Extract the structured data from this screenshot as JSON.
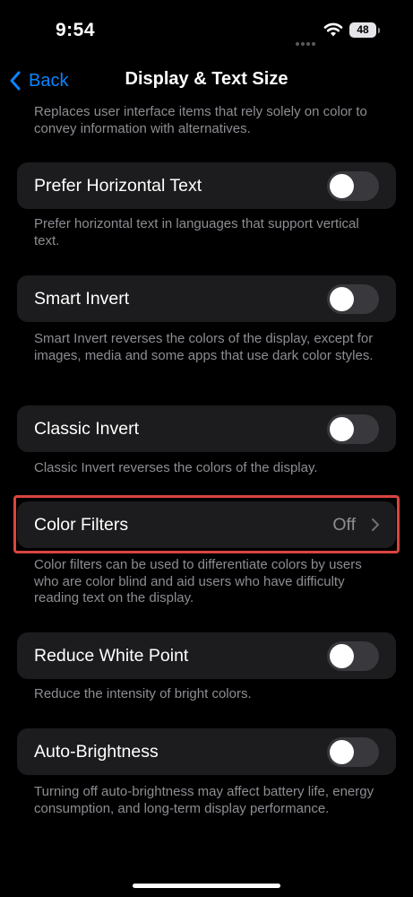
{
  "status_bar": {
    "time": "9:54",
    "battery": "48"
  },
  "nav": {
    "back_label": "Back",
    "title": "Display & Text Size"
  },
  "items": [
    {
      "footer": "Replaces user interface items that rely solely on color to convey information with alternatives."
    },
    {
      "label": "Prefer Horizontal Text",
      "toggle_on": false,
      "footer": "Prefer horizontal text in languages that support vertical text."
    },
    {
      "label": "Smart Invert",
      "toggle_on": false,
      "footer": "Smart Invert reverses the colors of the display, except for images, media and some apps that use dark color styles."
    },
    {
      "label": "Classic Invert",
      "toggle_on": false,
      "footer": "Classic Invert reverses the colors of the display."
    },
    {
      "label": "Color Filters",
      "value": "Off",
      "footer": "Color filters can be used to differentiate colors by users who are color blind and aid users who have difficulty reading text on the display."
    },
    {
      "label": "Reduce White Point",
      "toggle_on": false,
      "footer": "Reduce the intensity of bright colors."
    },
    {
      "label": "Auto-Brightness",
      "toggle_on": false,
      "footer": "Turning off auto-brightness may affect battery life, energy consumption, and long-term display performance."
    }
  ],
  "colors": {
    "accent": "#0a84ff",
    "highlight": "#d9453f",
    "cell": "#1c1c1e",
    "toggle_off": "#39393d"
  }
}
